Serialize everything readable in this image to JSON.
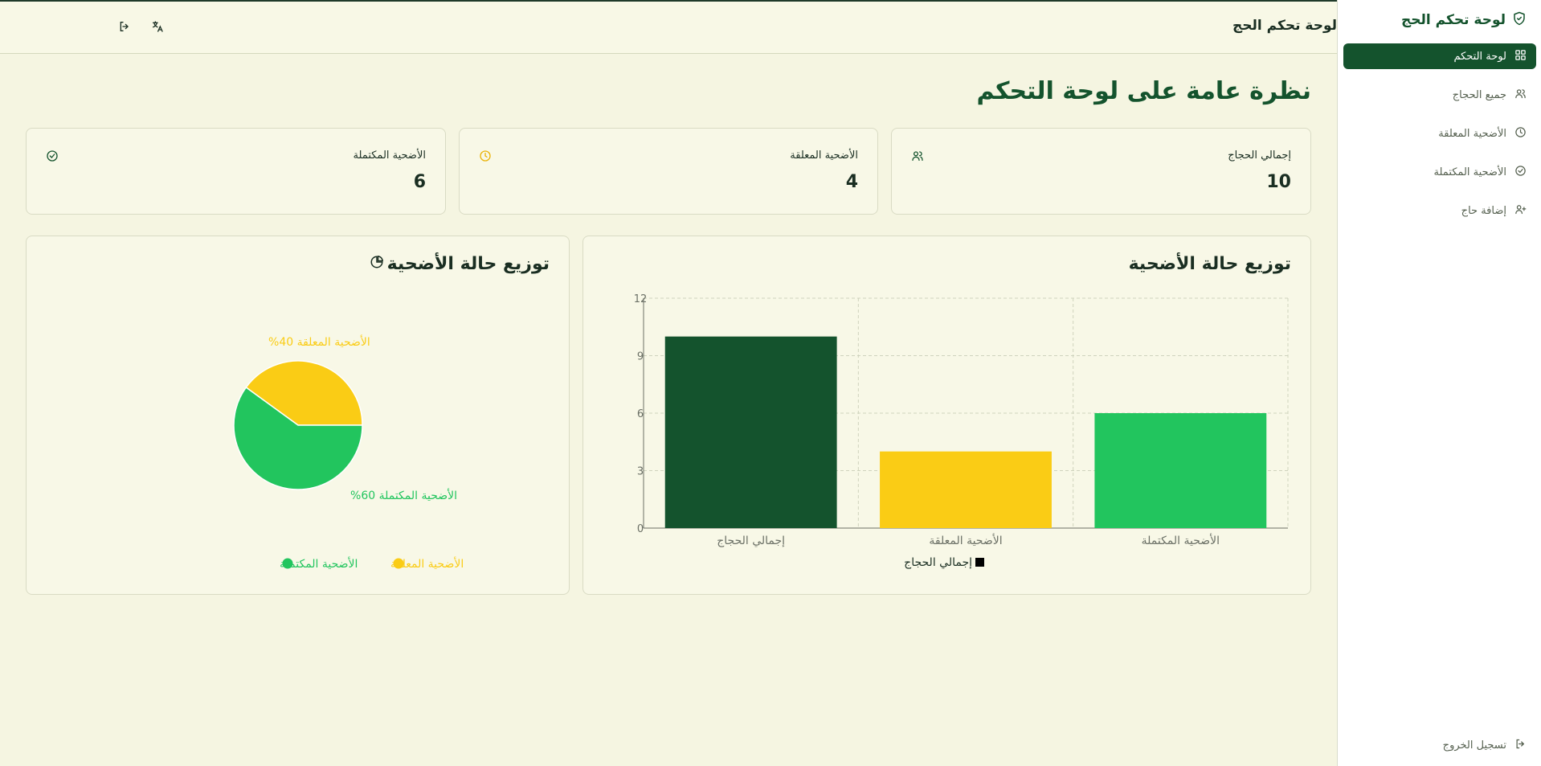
{
  "colors": {
    "primary": "#14532d",
    "total": "#14532d",
    "pending": "#facc15",
    "completed": "#22c55e",
    "grid": "#cfd3bd"
  },
  "sidebar": {
    "brand_title": "لوحة تحكم الحج",
    "brand_icon": "shield-check-icon",
    "items": [
      {
        "label": "لوحة التحكم",
        "icon": "dashboard-grid-icon",
        "active": true
      },
      {
        "label": "جميع الحجاج",
        "icon": "users-icon",
        "active": false
      },
      {
        "label": "الأضحية المعلقة",
        "icon": "clock-icon",
        "active": false
      },
      {
        "label": "الأضحية المكتملة",
        "icon": "check-circle-icon",
        "active": false
      },
      {
        "label": "إضافة حاج",
        "icon": "user-plus-icon",
        "active": false
      }
    ],
    "logout_label": "تسجيل الخروج"
  },
  "header": {
    "title": "لوحة تحكم الحج",
    "logout_icon": "logout-icon",
    "language_icon": "translate-icon"
  },
  "main": {
    "page_title": "نظرة عامة على لوحة التحكم",
    "stats": [
      {
        "label": "إجمالي الحجاج",
        "value": "10",
        "icon": "users-icon"
      },
      {
        "label": "الأضحية المعلقة",
        "value": "4",
        "icon": "clock-icon"
      },
      {
        "label": "الأضحية المكتملة",
        "value": "6",
        "icon": "check-circle-icon"
      }
    ],
    "bar_panel_title": "توزيع حالة الأضحية",
    "pie_panel_title": "توزيع حالة الأضحية"
  },
  "chart_data": [
    {
      "type": "bar",
      "title": "توزيع حالة الأضحية",
      "categories": [
        "إجمالي الحجاج",
        "الأضحية المعلقة",
        "الأضحية المكتملة"
      ],
      "values": [
        10,
        4,
        6
      ],
      "colors": [
        "#14532d",
        "#facc15",
        "#22c55e"
      ],
      "yticks": [
        0,
        3,
        6,
        9,
        12
      ],
      "ylim": [
        0,
        12
      ],
      "grid": true,
      "legend": [
        "إجمالي الحجاج"
      ],
      "legend_position": "bottom"
    },
    {
      "type": "pie",
      "title": "توزيع حالة الأضحية",
      "labels": [
        "الأضحية المعلقة",
        "الأضحية المكتملة"
      ],
      "values": [
        4,
        6
      ],
      "slice_labels": [
        "الأضحية المعلقة 40%",
        "الأضحية المكتملة 60%"
      ],
      "colors": [
        "#facc15",
        "#22c55e"
      ],
      "legend_position": "bottom"
    }
  ]
}
